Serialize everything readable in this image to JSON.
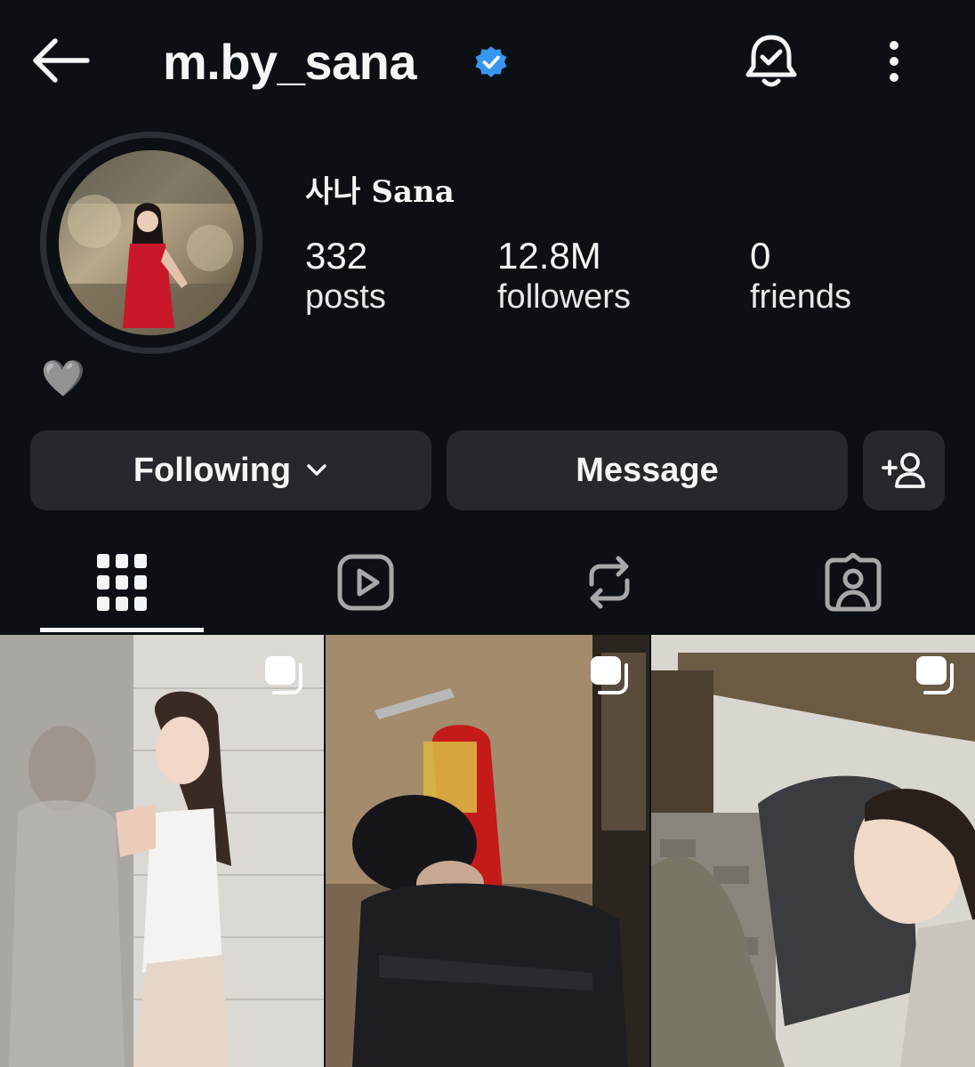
{
  "header": {
    "username": "m.by_sana",
    "verified": true,
    "icons": [
      "back-arrow-icon",
      "verified-badge-icon",
      "notification-bell-icon",
      "more-options-icon"
    ]
  },
  "profile": {
    "display_name": "사나 Sana",
    "bio": "🩶",
    "stats": [
      {
        "value": "332",
        "label": "posts"
      },
      {
        "value": "12.8M",
        "label": "followers"
      },
      {
        "value": "0",
        "label": "friends"
      }
    ]
  },
  "actions": {
    "following_label": "Following",
    "message_label": "Message"
  },
  "tabs": [
    {
      "name": "posts-grid",
      "icon": "grid-icon",
      "active": true
    },
    {
      "name": "reels",
      "icon": "reels-play-icon",
      "active": false
    },
    {
      "name": "reposts",
      "icon": "repost-icon",
      "active": false
    },
    {
      "name": "tagged",
      "icon": "tagged-person-icon",
      "active": false
    }
  ],
  "posts": [
    {
      "type": "carousel"
    },
    {
      "type": "carousel"
    },
    {
      "type": "carousel"
    }
  ],
  "colors": {
    "background": "#0c1014",
    "button": "#25292e",
    "verified": "#3797f0",
    "text": "#f5f5f5"
  }
}
